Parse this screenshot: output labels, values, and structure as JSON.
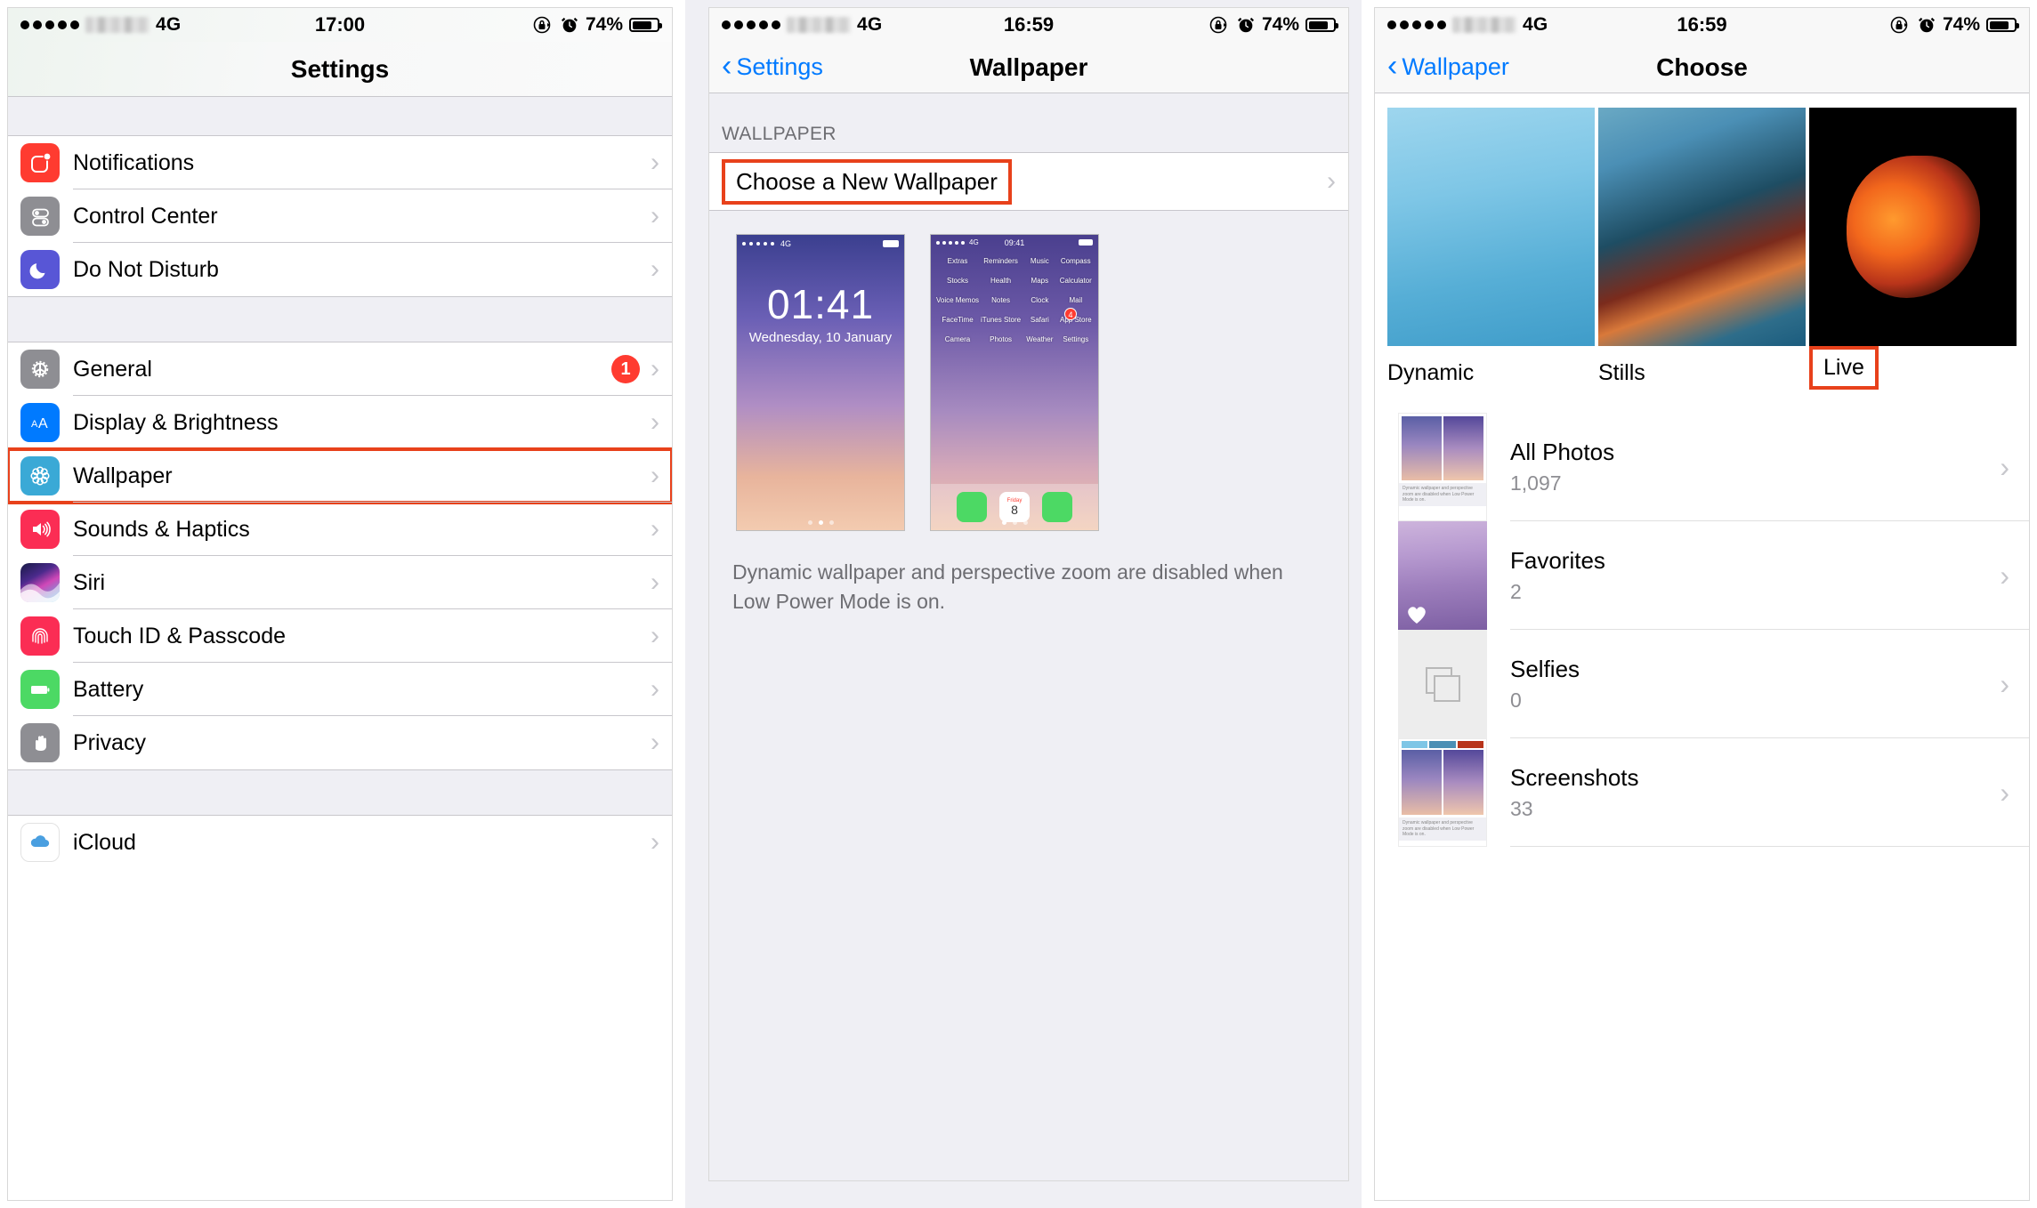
{
  "status_bar": {
    "signal_dots": 5,
    "network": "4G",
    "time_left": "17:00",
    "time_mid": "16:59",
    "time_right": "16:59",
    "battery_pct": "74%",
    "icons": [
      "rotation-lock-icon",
      "alarm-clock-icon",
      "battery-icon"
    ]
  },
  "panel1": {
    "title": "Settings",
    "group1": [
      {
        "label": "Notifications",
        "icon": "notifications-icon",
        "color": "#ff3b30"
      },
      {
        "label": "Control Center",
        "icon": "control-center-icon",
        "color": "#8e8e93"
      },
      {
        "label": "Do Not Disturb",
        "icon": "moon-icon",
        "color": "#5856d6"
      }
    ],
    "group2": [
      {
        "label": "General",
        "icon": "gear-icon",
        "color": "#8e8e93",
        "badge": "1",
        "highlighted": false
      },
      {
        "label": "Display & Brightness",
        "icon": "text-size-icon",
        "color": "#007aff",
        "highlighted": false
      },
      {
        "label": "Wallpaper",
        "icon": "wallpaper-flower-icon",
        "color": "#3aa9d6",
        "highlighted": true
      },
      {
        "label": "Sounds & Haptics",
        "icon": "speaker-icon",
        "color": "#fb2d54",
        "highlighted": false
      },
      {
        "label": "Siri",
        "icon": "siri-icon",
        "color": "#2b2b6b",
        "highlighted": false
      },
      {
        "label": "Touch ID & Passcode",
        "icon": "fingerprint-icon",
        "color": "#fb2d54",
        "highlighted": false
      },
      {
        "label": "Battery",
        "icon": "battery-icon",
        "color": "#4cd964",
        "highlighted": false
      },
      {
        "label": "Privacy",
        "icon": "hand-icon",
        "color": "#8e8e93",
        "highlighted": false
      }
    ],
    "group3": [
      {
        "label": "iCloud",
        "icon": "icloud-icon",
        "color": "#ffffff"
      }
    ]
  },
  "panel2": {
    "back_label": "Settings",
    "title": "Wallpaper",
    "section_header": "WALLPAPER",
    "choose_row": {
      "label": "Choose a New Wallpaper",
      "highlighted": true
    },
    "lock_preview": {
      "time": "01:41",
      "date": "Wednesday, 10 January",
      "network": "4G"
    },
    "home_preview": {
      "time": "09:41",
      "network": "4G",
      "apps": [
        {
          "name": "Extras"
        },
        {
          "name": "Reminders"
        },
        {
          "name": "Music"
        },
        {
          "name": "Compass"
        },
        {
          "name": "Stocks"
        },
        {
          "name": "Health"
        },
        {
          "name": "Maps"
        },
        {
          "name": "Calculator"
        },
        {
          "name": "Voice Memos"
        },
        {
          "name": "Notes"
        },
        {
          "name": "Clock"
        },
        {
          "name": "Mail"
        },
        {
          "name": "FaceTime"
        },
        {
          "name": "iTunes Store"
        },
        {
          "name": "Safari"
        },
        {
          "name": "App Store",
          "badge": "4"
        },
        {
          "name": "Camera"
        },
        {
          "name": "Photos"
        },
        {
          "name": "Weather"
        },
        {
          "name": "Settings"
        }
      ],
      "dock": [
        "Phone",
        "Calendar",
        "Messages"
      ],
      "calendar_day_name": "Friday",
      "calendar_day_num": "8"
    },
    "footnote": "Dynamic wallpaper and perspective zoom are disabled when Low Power Mode is on."
  },
  "panel3": {
    "back_label": "Wallpaper",
    "title": "Choose",
    "categories": [
      {
        "label": "Dynamic",
        "highlighted": false
      },
      {
        "label": "Stills",
        "highlighted": false
      },
      {
        "label": "Live",
        "highlighted": true
      }
    ],
    "albums": [
      {
        "name": "All Photos",
        "count": "1,097",
        "thumb": "screenshot-collage"
      },
      {
        "name": "Favorites",
        "count": "2",
        "thumb": "mountain-heart"
      },
      {
        "name": "Selfies",
        "count": "0",
        "thumb": "empty-stack"
      },
      {
        "name": "Screenshots",
        "count": "33",
        "thumb": "screenshot-collage"
      }
    ]
  },
  "colors": {
    "highlight": "#e8411b",
    "accent_blue": "#007aff",
    "group_bg": "#efeff4",
    "separator": "#c8c7cc",
    "secondary_text": "#8e8e93"
  }
}
